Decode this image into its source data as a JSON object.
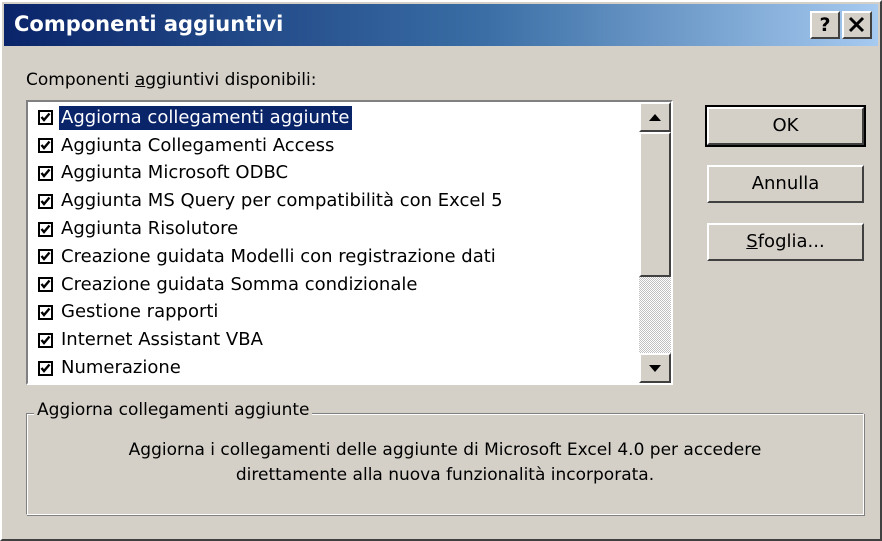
{
  "window": {
    "title": "Componenti aggiuntivi",
    "help_label": "?",
    "close_label": "✕"
  },
  "list": {
    "label_prefix": "Componenti ",
    "label_mnemonic": "a",
    "label_suffix": "ggiuntivi disponibili:",
    "items": [
      {
        "label": "Aggiorna collegamenti aggiunte",
        "checked": true,
        "selected": true
      },
      {
        "label": "Aggiunta Collegamenti Access",
        "checked": true
      },
      {
        "label": "Aggiunta Microsoft ODBC",
        "checked": true
      },
      {
        "label": "Aggiunta MS Query per compatibilità con Excel 5",
        "checked": true
      },
      {
        "label": "Aggiunta Risolutore",
        "checked": true
      },
      {
        "label": "Creazione guidata Modelli con registrazione dati",
        "checked": true
      },
      {
        "label": "Creazione guidata Somma condizionale",
        "checked": true
      },
      {
        "label": "Gestione rapporti",
        "checked": true
      },
      {
        "label": "Internet Assistant VBA",
        "checked": true
      },
      {
        "label": "Numerazione",
        "checked": true
      }
    ]
  },
  "buttons": {
    "ok_label": "OK",
    "cancel_label": "Annulla",
    "browse_mnemonic": "S",
    "browse_rest": "foglia..."
  },
  "description": {
    "title": "Aggiorna collegamenti aggiunte",
    "line1": "Aggiorna i collegamenti delle aggiunte di Microsoft Excel 4.0 per accedere",
    "line2": "direttamente alla nuova funzionalità incorporata."
  },
  "colors": {
    "title_start": "#0a246a",
    "title_end": "#a6caf0",
    "face": "#d4d0c8",
    "selection": "#0a246a"
  }
}
